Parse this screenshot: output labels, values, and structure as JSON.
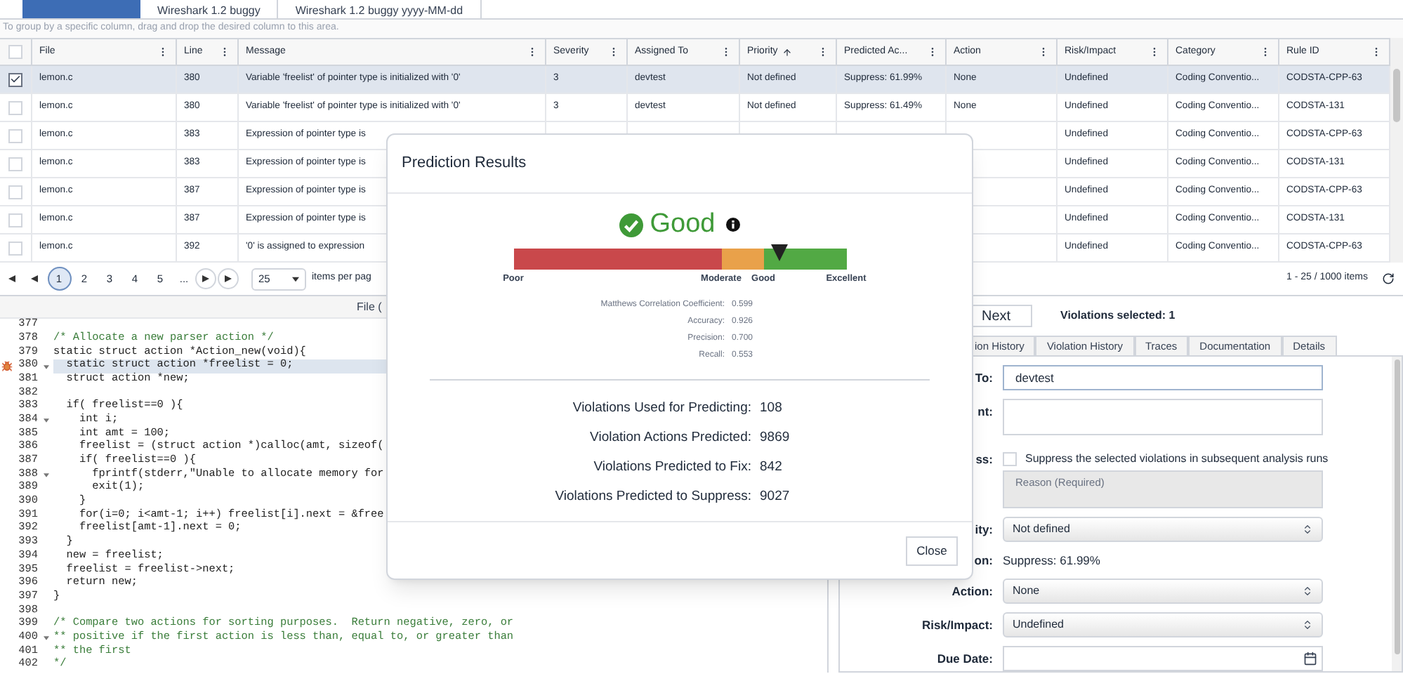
{
  "tabs": [
    {
      "selected": true
    },
    {
      "label": "Wireshark 1.2 buggy",
      "selected": false
    },
    {
      "label": "Wireshark 1.2 buggy yyyy-MM-dd",
      "selected": false
    }
  ],
  "group_hint": "To group by a specific column, drag and drop the desired column to this area.",
  "table": {
    "header_checked": false,
    "columns": [
      {
        "label": "File",
        "sorted": false
      },
      {
        "label": "Line",
        "sorted": false
      },
      {
        "label": "Message",
        "sorted": false
      },
      {
        "label": "Severity",
        "sorted": false
      },
      {
        "label": "Assigned To",
        "sorted": false
      },
      {
        "label": "Priority",
        "sorted": true
      },
      {
        "label": "Predicted Ac...",
        "sorted": false
      },
      {
        "label": "Action",
        "sorted": false
      },
      {
        "label": "Risk/Impact",
        "sorted": false
      },
      {
        "label": "Category",
        "sorted": false
      },
      {
        "label": "Rule ID",
        "sorted": false
      }
    ],
    "rows": [
      {
        "selected": true,
        "cells": {
          "file": "lemon.c",
          "line": "380",
          "message": "Variable 'freelist' of pointer type is initialized with '0'",
          "severity": "3",
          "assigned_to": "devtest",
          "priority": "Not defined",
          "predicted_action": "Suppress: 61.99%",
          "action": "None",
          "risk_impact": "Undefined",
          "category": "Coding Conventio...",
          "rule_id": "CODSTA-CPP-63"
        }
      },
      {
        "selected": false,
        "cells": {
          "file": "lemon.c",
          "line": "380",
          "message": "Variable 'freelist' of pointer type is initialized with '0'",
          "severity": "3",
          "assigned_to": "devtest",
          "priority": "Not defined",
          "predicted_action": "Suppress: 61.49%",
          "action": "None",
          "risk_impact": "Undefined",
          "category": "Coding Conventio...",
          "rule_id": "CODSTA-131"
        }
      },
      {
        "selected": false,
        "cells": {
          "file": "lemon.c",
          "line": "383",
          "message": "Expression of pointer type is",
          "risk_impact": "Undefined",
          "category": "Coding Conventio...",
          "rule_id": "CODSTA-CPP-63"
        }
      },
      {
        "selected": false,
        "cells": {
          "file": "lemon.c",
          "line": "383",
          "message": "Expression of pointer type is",
          "risk_impact": "Undefined",
          "category": "Coding Conventio...",
          "rule_id": "CODSTA-131"
        }
      },
      {
        "selected": false,
        "cells": {
          "file": "lemon.c",
          "line": "387",
          "message": "Expression of pointer type is",
          "risk_impact": "Undefined",
          "category": "Coding Conventio...",
          "rule_id": "CODSTA-CPP-63"
        }
      },
      {
        "selected": false,
        "cells": {
          "file": "lemon.c",
          "line": "387",
          "message": "Expression of pointer type is",
          "risk_impact": "Undefined",
          "category": "Coding Conventio...",
          "rule_id": "CODSTA-131"
        }
      },
      {
        "selected": false,
        "cells": {
          "file": "lemon.c",
          "line": "392",
          "message": "'0' is assigned to expression",
          "risk_impact": "Undefined",
          "category": "Coding Conventio...",
          "rule_id": "CODSTA-CPP-63"
        }
      }
    ]
  },
  "pagination": {
    "pages": [
      {
        "label": "1",
        "selected": true
      },
      {
        "label": "2",
        "selected": false
      },
      {
        "label": "3",
        "selected": false
      },
      {
        "label": "4",
        "selected": false
      },
      {
        "label": "5",
        "selected": false
      }
    ],
    "ellipsis": "...",
    "page_size": "25",
    "page_size_label": "items per pag",
    "summary": "1 - 25 / 1000 items"
  },
  "code": {
    "title": "File (",
    "lines": [
      {
        "number": "377",
        "selected": false,
        "fold": false,
        "flagged": false
      },
      {
        "number": "378",
        "kind": "comment",
        "text": "/* Allocate a new parser action */",
        "selected": false,
        "fold": false,
        "flagged": false
      },
      {
        "number": "379",
        "kind": "code",
        "text": "static struct action *Action_new(void){",
        "selected": false,
        "fold": false,
        "flagged": false
      },
      {
        "number": "380",
        "kind": "code",
        "text": "  static struct action *freelist = 0;",
        "selected": true,
        "fold": true,
        "flagged": true
      },
      {
        "number": "381",
        "kind": "code",
        "text": "  struct action *new;",
        "selected": false,
        "fold": false,
        "flagged": false
      },
      {
        "number": "382",
        "selected": false,
        "fold": false,
        "flagged": false
      },
      {
        "number": "383",
        "kind": "code",
        "text": "  if( freelist==0 ){",
        "selected": false,
        "fold": false,
        "flagged": false
      },
      {
        "number": "384",
        "kind": "code",
        "text": "    int i;",
        "selected": false,
        "fold": true,
        "flagged": false
      },
      {
        "number": "385",
        "kind": "code",
        "text": "    int amt = 100;",
        "selected": false,
        "fold": false,
        "flagged": false
      },
      {
        "number": "386",
        "kind": "code",
        "text": "    freelist = (struct action *)calloc(amt, sizeof(",
        "selected": false,
        "fold": false,
        "flagged": false
      },
      {
        "number": "387",
        "kind": "code",
        "text": "    if( freelist==0 ){",
        "selected": false,
        "fold": false,
        "flagged": false
      },
      {
        "number": "388",
        "kind": "code",
        "text": "      fprintf(stderr,\"Unable to allocate memory for",
        "selected": false,
        "fold": true,
        "flagged": false
      },
      {
        "number": "389",
        "kind": "code",
        "text": "      exit(1);",
        "selected": false,
        "fold": false,
        "flagged": false
      },
      {
        "number": "390",
        "kind": "code",
        "text": "    }",
        "selected": false,
        "fold": false,
        "flagged": false
      },
      {
        "number": "391",
        "kind": "code",
        "text": "    for(i=0; i<amt-1; i++) freelist[i].next = &free",
        "selected": false,
        "fold": false,
        "flagged": false
      },
      {
        "number": "392",
        "kind": "code",
        "text": "    freelist[amt-1].next = 0;",
        "selected": false,
        "fold": false,
        "flagged": false
      },
      {
        "number": "393",
        "kind": "code",
        "text": "  }",
        "selected": false,
        "fold": false,
        "flagged": false
      },
      {
        "number": "394",
        "kind": "code",
        "text": "  new = freelist;",
        "selected": false,
        "fold": false,
        "flagged": false
      },
      {
        "number": "395",
        "kind": "code",
        "text": "  freelist = freelist->next;",
        "selected": false,
        "fold": false,
        "flagged": false
      },
      {
        "number": "396",
        "kind": "code",
        "text": "  return new;",
        "selected": false,
        "fold": false,
        "flagged": false
      },
      {
        "number": "397",
        "kind": "code",
        "text": "}",
        "selected": false,
        "fold": false,
        "flagged": false
      },
      {
        "number": "398",
        "selected": false,
        "fold": false,
        "flagged": false
      },
      {
        "number": "399",
        "kind": "comment",
        "text": "/* Compare two actions for sorting purposes.  Return negative, zero, or",
        "selected": false,
        "fold": false,
        "flagged": false
      },
      {
        "number": "400",
        "kind": "comment",
        "text": "** positive if the first action is less than, equal to, or greater than",
        "selected": false,
        "fold": true,
        "flagged": false
      },
      {
        "number": "401",
        "kind": "comment",
        "text": "** the first",
        "selected": false,
        "fold": false,
        "flagged": false
      },
      {
        "number": "402",
        "kind": "comment",
        "text": "*/",
        "selected": false,
        "fold": false,
        "flagged": false
      }
    ]
  },
  "details": {
    "next": "Next",
    "selection": "Violations selected: 1",
    "tabs": [
      {
        "label": "ion History",
        "selected": false
      },
      {
        "label": "Violation History",
        "selected": false
      },
      {
        "label": "Traces",
        "selected": false
      },
      {
        "label": "Documentation",
        "selected": false
      },
      {
        "label": "Details",
        "selected": false
      }
    ],
    "form": [
      {
        "kind": "input",
        "label": "To:",
        "value": "devtest"
      },
      {
        "kind": "textarea",
        "label": "nt:"
      },
      {
        "kind": "checkbox",
        "label": "ss:",
        "text": "Suppress the selected violations in subsequent analysis runs",
        "checked": false,
        "placeholder": "Reason (Required)"
      },
      {
        "kind": "select",
        "label": "ity:",
        "value": "Not defined"
      },
      {
        "kind": "text",
        "label": "on:",
        "value": "Suppress: 61.99%"
      },
      {
        "kind": "select",
        "label": "Action:",
        "value": "None"
      },
      {
        "kind": "select",
        "label": "Risk/Impact:",
        "value": "Undefined"
      },
      {
        "kind": "date",
        "label": "Due Date:"
      }
    ]
  },
  "modal": {
    "title": "Prediction Results",
    "rating": "Good",
    "gauge": {
      "level": 0.8,
      "segments": [
        {
          "color": "#c9484b"
        },
        {
          "color": "#e9a14a"
        },
        {
          "color": "#52a944"
        }
      ],
      "labels": [
        "Poor",
        "Moderate",
        "Good",
        "Excellent"
      ]
    },
    "metrics": [
      {
        "label": "Matthews Correlation Coefficient:",
        "value": "0.599"
      },
      {
        "label": "Accuracy:",
        "value": "0.926"
      },
      {
        "label": "Precision:",
        "value": "0.700"
      },
      {
        "label": "Recall:",
        "value": "0.553"
      }
    ],
    "stats": [
      {
        "label": "Violations Used for Predicting:",
        "value": "108"
      },
      {
        "label": "Violation Actions Predicted:",
        "value": "9869"
      },
      {
        "label": "Violations Predicted to Fix:",
        "value": "842"
      },
      {
        "label": "Violations Predicted to Suppress:",
        "value": "9027"
      }
    ],
    "close": "Close"
  }
}
